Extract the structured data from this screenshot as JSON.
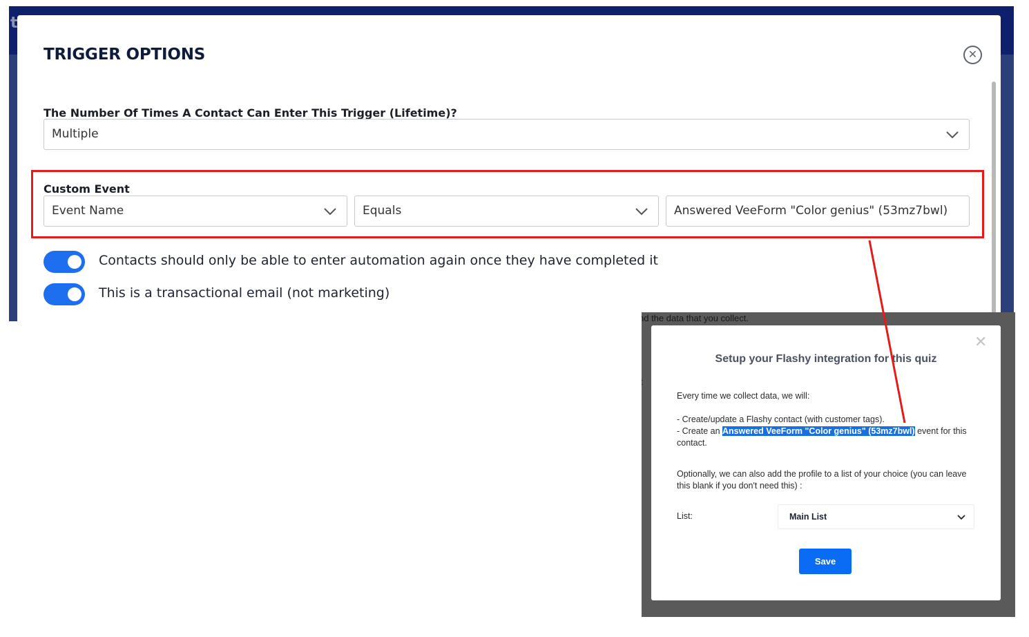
{
  "background": {
    "partial_letter": "t",
    "partial_text_1": "nd the data that you collect.",
    "partial_text_2": "t"
  },
  "trigger_modal": {
    "title": "TRIGGER OPTIONS",
    "close_icon": "close-circle-icon",
    "lifetime_label": "The Number Of Times A Contact Can Enter This Trigger (Lifetime)?",
    "lifetime_value": "Multiple",
    "custom_event": {
      "label": "Custom Event",
      "field_value": "Event Name",
      "operator_value": "Equals",
      "input_value": "Answered VeeForm \"Color genius\" (53mz7bwl)"
    },
    "toggles": [
      {
        "label": "Contacts should only be able to enter automation again once they have completed it",
        "on": true
      },
      {
        "label": "This is a transactional email (not marketing)",
        "on": true
      }
    ]
  },
  "flashy_modal": {
    "title": "Setup your Flashy integration for this quiz",
    "close_icon": "close-x-icon",
    "intro": "Every time we collect data, we will:",
    "bullet_1": "- Create/update a Flashy contact (with customer tags).",
    "bullet_2_prefix": "- Create an ",
    "bullet_2_highlight": "Answered VeeForm \"Color genius\" (53mz7bwl)",
    "bullet_2_suffix": " event for this contact.",
    "optional_text": "Optionally, we can also add the profile to a list of your choice (you can leave this blank if you don't need this) :",
    "list_label": "List:",
    "list_value": "Main List",
    "save_label": "Save"
  },
  "colors": {
    "annotation_red": "#e31b1b",
    "toggle_blue": "#1e6ff0",
    "highlight_blue": "#1a6fe0",
    "save_blue": "#0a6cf5"
  }
}
